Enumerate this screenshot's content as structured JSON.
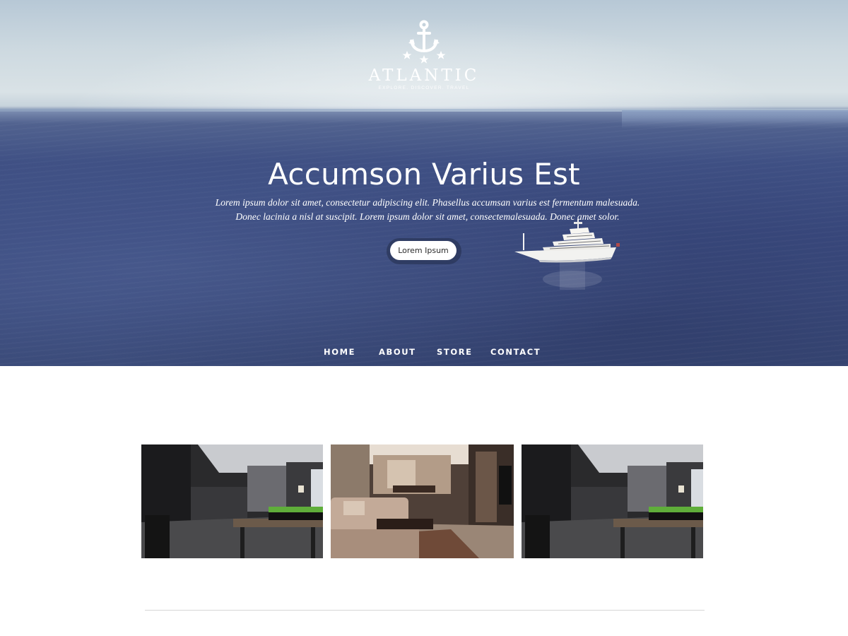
{
  "brand": {
    "name": "ATLANTIC",
    "tagline": "EXPLORE. DISCOVER. TRAVEL",
    "logo_icon": "anchor-with-stars"
  },
  "hero": {
    "title": "Accumson Varius Est",
    "text_line1": "Lorem ipsum dolor sit amet, consectetur adipiscing elit. Phasellus accumsan varius est fermentum malesuada.",
    "text_line2": "Donec lacinia a nisl at suscipit. Lorem ipsum dolor sit amet, consectemalesuada. Donec amet solor.",
    "button_label": "Lorem Ipsum"
  },
  "nav": {
    "items": [
      {
        "label": "HOME"
      },
      {
        "label": "ABOUT"
      },
      {
        "label": "STORE"
      },
      {
        "label": "CONTACT"
      }
    ]
  },
  "gallery": {
    "images": [
      {
        "subject": "modern dark interior with dining table and grass planter"
      },
      {
        "subject": "living room with beige sofa and dining area"
      },
      {
        "subject": "modern dark interior with dining table and grass planter"
      }
    ]
  },
  "colors": {
    "sea": "#3d4d80",
    "sky": "#d9e2e6",
    "button_bg": "#ffffff",
    "text_light": "#ffffff"
  }
}
